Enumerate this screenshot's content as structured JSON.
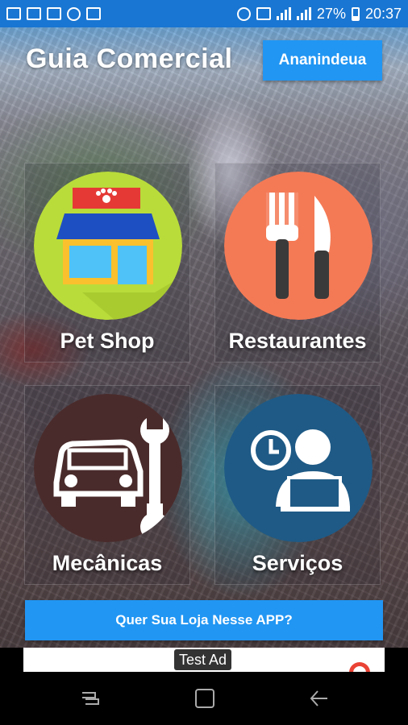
{
  "status_bar": {
    "battery": "27%",
    "time": "20:37",
    "icons": [
      "sim-card-icon",
      "sim-card-icon",
      "image-icon",
      "whatsapp-icon",
      "wifi-icon",
      "alarm-icon",
      "nfc-icon",
      "signal-icon",
      "battery-icon"
    ]
  },
  "header": {
    "title": "Guia Comercial",
    "city_button": "Ananindeua"
  },
  "categories": [
    {
      "label": "Pet Shop",
      "icon": "pet-shop-icon",
      "color": "#b9dc3a"
    },
    {
      "label": "Restaurantes",
      "icon": "fork-knife-icon",
      "color": "#f47a55"
    },
    {
      "label": "Mecânicas",
      "icon": "car-wrench-icon",
      "color": "#4a2b2b"
    },
    {
      "label": "Serviços",
      "icon": "person-laptop-icon",
      "color": "#1f5a86"
    }
  ],
  "cta": {
    "label": "Quer Sua Loja Nesse APP?"
  },
  "ad": {
    "label": "Test Ad"
  },
  "colors": {
    "accent": "#2196f3",
    "status_bar": "#1976d2"
  }
}
